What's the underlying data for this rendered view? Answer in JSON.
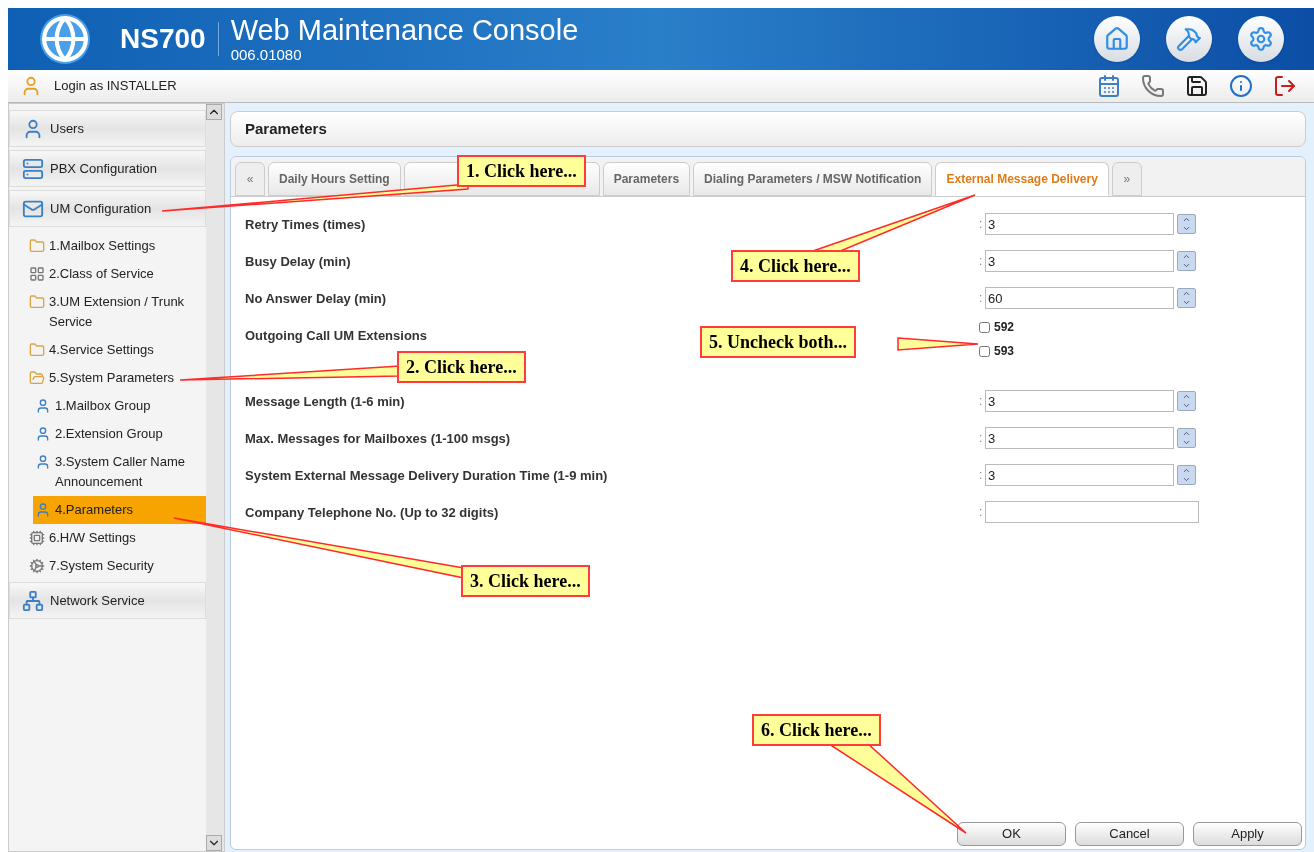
{
  "header": {
    "product": "NS700",
    "title": "Web Maintenance Console",
    "version": "006.01080"
  },
  "login": {
    "text": "Login as INSTALLER"
  },
  "sidebar": {
    "sections": [
      {
        "label": "Users",
        "kind": "users"
      },
      {
        "label": "PBX Configuration",
        "kind": "pbx"
      },
      {
        "label": "UM Configuration",
        "kind": "um",
        "children": [
          {
            "label": "1.Mailbox Settings",
            "kind": "folder",
            "expanded": false,
            "selected": false
          },
          {
            "label": "2.Class of Service",
            "kind": "grid",
            "selected": false
          },
          {
            "label": "3.UM Extension / Trunk Service",
            "kind": "folder",
            "expanded": false,
            "selected": false
          },
          {
            "label": "4.Service Settings",
            "kind": "folder",
            "expanded": false,
            "selected": false
          },
          {
            "label": "5.System Parameters",
            "kind": "folder",
            "expanded": true,
            "selected": false,
            "children": [
              {
                "label": "1.Mailbox Group",
                "kind": "person",
                "selected": false
              },
              {
                "label": "2.Extension Group",
                "kind": "person",
                "selected": false
              },
              {
                "label": "3.System Caller Name Announcement",
                "kind": "person",
                "selected": false
              },
              {
                "label": "4.Parameters",
                "kind": "person",
                "selected": true
              }
            ]
          },
          {
            "label": "6.H/W Settings",
            "kind": "hw",
            "selected": false
          },
          {
            "label": "7.System Security",
            "kind": "security",
            "selected": false
          }
        ]
      },
      {
        "label": "Network Service",
        "kind": "network"
      }
    ]
  },
  "panel": {
    "title": "Parameters"
  },
  "tabs": {
    "prev": "«",
    "next": "»",
    "items": [
      {
        "label": "Daily Hours Setting",
        "selected": false
      },
      {
        "selected": false
      },
      {
        "label": "Parameters",
        "selected": false
      },
      {
        "label": "Dialing Parameters / MSW Notification",
        "selected": false
      },
      {
        "label": "External Message Delivery",
        "selected": true
      }
    ]
  },
  "form": {
    "rows": [
      {
        "kind": "spin",
        "label": "Retry Times (times)",
        "colon": ":",
        "value": "3"
      },
      {
        "kind": "spin",
        "label": "Busy Delay (min)",
        "colon": ":",
        "value": "3"
      },
      {
        "kind": "spin",
        "label": "No Answer Delay (min)",
        "colon": ":",
        "value": "60"
      },
      {
        "kind": "checks",
        "label": "Outgoing Call UM Extensions",
        "options": [
          {
            "label": "592",
            "checked": false
          },
          {
            "label": "593",
            "checked": false
          }
        ]
      },
      {
        "kind": "spin",
        "label": "Message Length (1-6 min)",
        "colon": ":",
        "value": "3"
      },
      {
        "kind": "spin",
        "label": "Max. Messages for Mailboxes (1-100 msgs)",
        "colon": ":",
        "value": "3"
      },
      {
        "kind": "spin",
        "label": "System External Message Delivery Duration Time (1-9 min)",
        "colon": ":",
        "value": "3"
      },
      {
        "kind": "text",
        "label": "Company Telephone No. (Up to 32 digits)",
        "colon": ":",
        "value": ""
      }
    ]
  },
  "buttons": [
    "OK",
    "Cancel",
    "Apply"
  ],
  "callouts": [
    "1. Click here...",
    "2. Click here...",
    "3. Click here...",
    "4. Click here...",
    "5. Uncheck both...",
    "6. Click here..."
  ]
}
